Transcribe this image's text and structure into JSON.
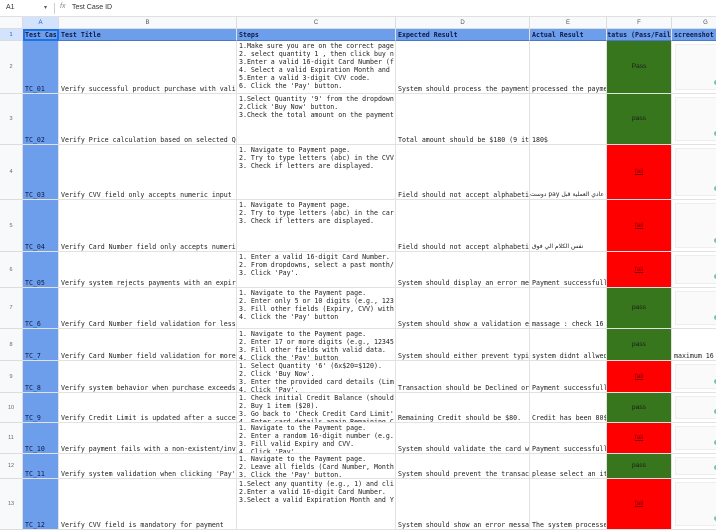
{
  "formula_bar": {
    "cell_ref": "A1",
    "formula_icon": "fx-icon",
    "value": "Test Case ID"
  },
  "columns": [
    "A",
    "B",
    "C",
    "D",
    "E",
    "F",
    "G"
  ],
  "headers": [
    "Test Case ID",
    "Test Title",
    "Steps",
    "Expected Result",
    "Actual Result",
    "Status (Pass/Fail)",
    "screenshot"
  ],
  "header_display": [
    "Test Cas",
    "Test Title",
    "Steps",
    "Expected Result",
    "Actual Result",
    "tatus (Pass/Fail",
    "screenshot"
  ],
  "colors": {
    "header": "#6d9eeb",
    "pass": "#38761d",
    "fail": "#ff0000"
  },
  "rows": [
    {
      "num": "2",
      "id": "TC_01",
      "title": "Verify successful product purchase with vali",
      "steps": "1.Make sure you are on the correct page\n2. select quantity 1 , then click buy n\n3.Enter a valid 16-digit Card Number (f\n4. Select a valid Expiration Month and\n5.Enter a valid 3-digit CVV code.\n6. Click the 'Pay' button.",
      "expected": "System should process the payment",
      "actual": "processed the payme",
      "status": "Pass"
    },
    {
      "num": "3",
      "id": "TC_02",
      "title": "Verify Price calculation based on selected Q",
      "steps": "1.Select Quantity '9' from the dropdown\n2.Click 'Buy Now' button.\n3.Check the total amount on the payment",
      "expected": "Total amount should be $180 (9 it",
      "actual": "180$",
      "status": "pass"
    },
    {
      "num": "4",
      "id": "TC_03",
      "title": "Verify CVV field only accepts numeric input",
      "steps": "1. Navigate to Payment page.\n2. Try to type letters (abc) in the CVV\n3. Check if letters are displayed.",
      "expected": "Field should not accept alphabeti",
      "actual": "عادي العملية قبل pay دوست",
      "status": "fail"
    },
    {
      "num": "5",
      "id": "TC_04",
      "title": "Verify Card Number field only accepts numeri",
      "steps": "1. Navigate to Payment page.\n2. Try to type letters (abc) in the car\n3. Check if letters are displayed.",
      "expected": "Field should not accept alphabeti",
      "actual": "نفس الكلام الي فوق",
      "status": "fail"
    },
    {
      "num": "6",
      "id": "TC_05",
      "title": "Verify system rejects payments with an expir",
      "steps": "1. Enter a valid 16-digit Card Number.\n2. From dropdowns, select a past month/\n3. Click 'Pay'.",
      "expected": "System should display an error me",
      "actual": "Payment successfull",
      "status": "fail"
    },
    {
      "num": "7",
      "id": "TC_6",
      "title": "Verify Card Number field validation for less",
      "steps": "1. Navigate to the Payment page.\n2. Enter only 5 or 10 digits (e.g., 123\n3. Fill other fields (Expiry, CVV) with\n4. Click the 'Pay' button",
      "expected": "System should show a validation e",
      "actual": "massage : check 16",
      "status": "pass"
    },
    {
      "num": "8",
      "id": "TC_7",
      "title": "Verify Card Number field validation for more",
      "steps": "1. Navigate to the Payment page.\n2. Enter 17 or more digits (e.g., 12345\n3. Fill other fields with valid data.\n4. Click the 'Pay' button",
      "expected": "System should either prevent typi",
      "actual": "system didnt allwed",
      "status": "pass",
      "screenshot_text": "maximum 16"
    },
    {
      "num": "9",
      "id": "TC_8",
      "title": "Verify system behavior when purchase exceeds",
      "steps": "1. Select Quantity '6' (6x$20=$120).\n2. Click 'Buy Now'.\n3. Enter the provided card details (Lim\n4. Click 'Pay'.",
      "expected": "Transaction should be Declined or",
      "actual": "Payment successfull",
      "status": "fail"
    },
    {
      "num": "10",
      "id": "TC_9",
      "title": "Verify Credit Limit is updated after a succe",
      "steps": "1. Check initial Credit Balance (should\n2. Buy 1 item ($20).\n3. Go back to 'Check Credit Card Limit'\n4. Enter card details again Remaining C",
      "expected": "Remaining Credit should be $80.",
      "actual": "Credit has been 80$",
      "status": "pass"
    },
    {
      "num": "11",
      "id": "TC_10",
      "title": "Verify payment fails with a non-existent/inv",
      "steps": "1. Navigate to the Payment page.\n2. Enter a random 16-digit number (e.g.\n3. Fill valid Expiry and CVV.\n4. Click 'Pay'.",
      "expected": "System should validate the card w",
      "actual": "Payment successfull",
      "status": "fail"
    },
    {
      "num": "12",
      "id": "TC_11",
      "title": "Verify system validation when clicking 'Pay'",
      "steps": "1. Navigate to the Payment page.\n2. Leave all fields (Card Number, Month\n3. Click the 'Pay' button.",
      "expected": "System should prevent the transac",
      "actual": "please select an it",
      "status": "pass"
    },
    {
      "num": "13",
      "id": "TC_12",
      "title": "Verify CVV field is mandatory for payment",
      "steps": "1.Select any quantity (e.g., 1) and cli\n2.Enter a valid 16-digit Card Number.\n3.Select a valid Expiration Month and Y",
      "expected": "System should show an error messa",
      "actual": "The system processe",
      "status": "fail"
    }
  ]
}
